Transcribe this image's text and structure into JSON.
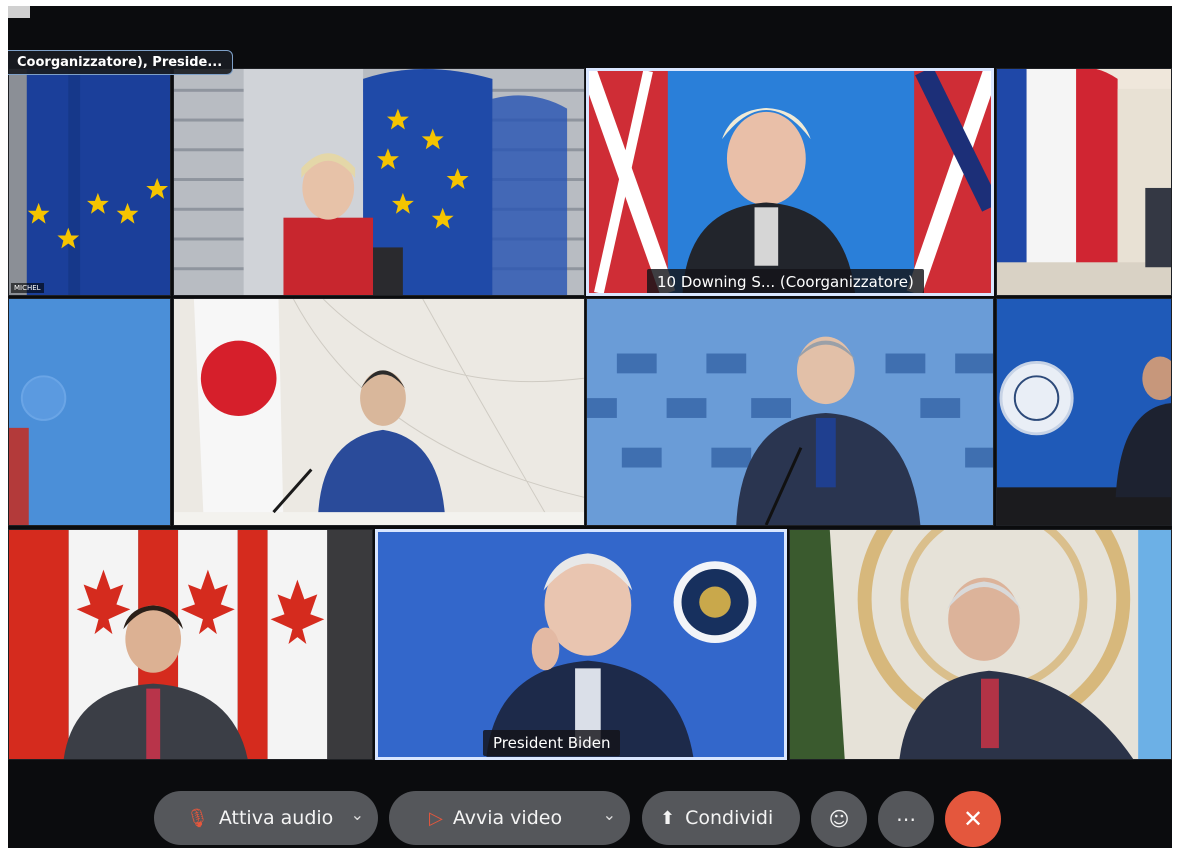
{
  "participants": {
    "top_left_label": "Coorganizzatore), Preside...",
    "michel_tag": "MICHEL",
    "uk_label": "10 Downing S... (Coorganizzatore)",
    "biden_label": "President Biden"
  },
  "toolbar": {
    "audio_label": "Attiva audio",
    "video_label": "Avvia video",
    "share_label": "Condividi",
    "reactions_icon": "smiley-icon",
    "more_icon": "ellipsis-icon",
    "end_icon": "close-icon"
  },
  "colors": {
    "end_call": "#e4573d",
    "control_bg": "#55575b",
    "active_border": "#d9e6ff"
  }
}
